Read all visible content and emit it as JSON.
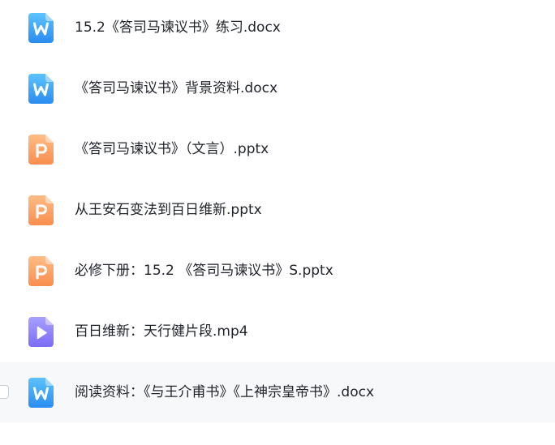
{
  "files": [
    {
      "name": "15.2《答司马谏议书》练习.docx",
      "type": "word",
      "icon": "word-doc-icon"
    },
    {
      "name": "《答司马谏议书》背景资料.docx",
      "type": "word",
      "icon": "word-doc-icon"
    },
    {
      "name": "《答司马谏议书》（文言）.pptx",
      "type": "ppt",
      "icon": "ppt-doc-icon"
    },
    {
      "name": "从王安石变法到百日维新.pptx",
      "type": "ppt",
      "icon": "ppt-doc-icon"
    },
    {
      "name": "必修下册：15.2 《答司马谏议书》S.pptx",
      "type": "ppt",
      "icon": "ppt-doc-icon"
    },
    {
      "name": "百日维新：天行健片段.mp4",
      "type": "video",
      "icon": "video-file-icon"
    },
    {
      "name": "阅读资料：《与王介甫书》《上神宗皇帝书》.docx",
      "type": "word",
      "icon": "word-doc-icon"
    }
  ],
  "colors": {
    "word_top": "#5cc3ff",
    "word_bottom": "#2a8cf0",
    "ppt_top": "#ffbd85",
    "ppt_bottom": "#f98d4e",
    "video_top": "#a9a0ff",
    "video_bottom": "#7a6cf5",
    "hover_row": "#f7f8fa",
    "text": "#1f2329"
  }
}
